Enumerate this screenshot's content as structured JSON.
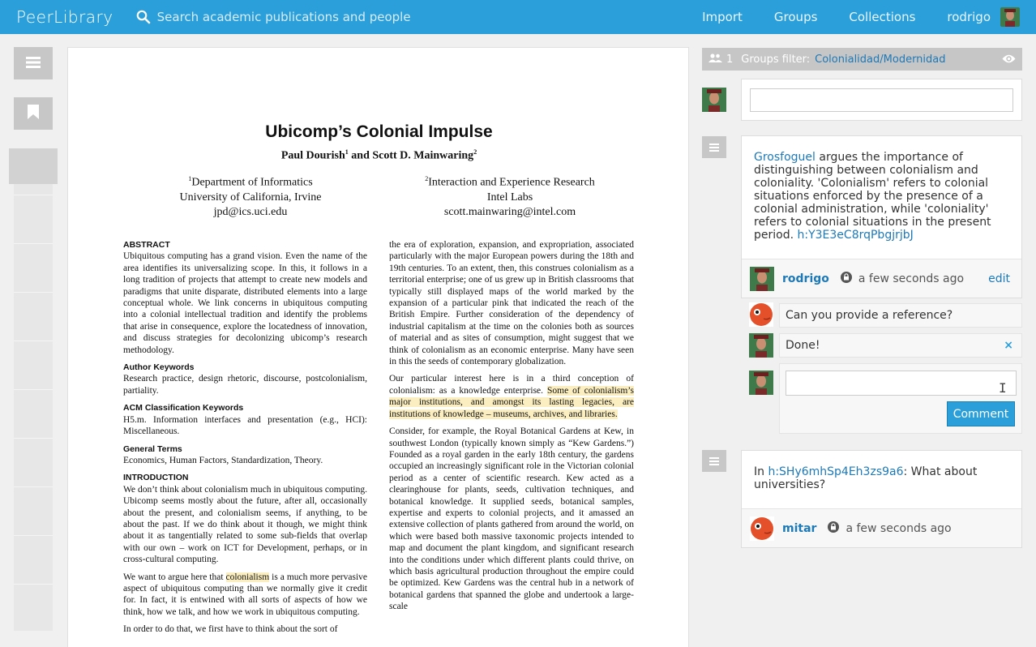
{
  "app": {
    "title": "PeerLibrary"
  },
  "search": {
    "placeholder": "Search academic publications and people"
  },
  "nav": {
    "import": "Import",
    "groups": "Groups",
    "collections": "Collections",
    "user": "rodrigo"
  },
  "paper": {
    "title": "Ubicomp’s Colonial Impulse",
    "authors": {
      "a1": "Paul Dourish",
      "a1_sup": "1",
      "and": " and ",
      "a2": "Scott D. Mainwaring",
      "a2_sup": "2"
    },
    "affiliations": [
      {
        "sup": "1",
        "line1": "Department of Informatics",
        "line2": "University of California, Irvine",
        "line3": "jpd@ics.uci.edu"
      },
      {
        "sup": "2",
        "line1": "Interaction and Experience Research",
        "line2": "Intel Labs",
        "line3": "scott.mainwaring@intel.com"
      }
    ],
    "left": {
      "abstract_h": "ABSTRACT",
      "abstract": "Ubiquitous computing has a grand vision. Even the name of the area identifies its universalizing scope. In this, it follows in a long tradition of projects that attempt to create new models and paradigms that unite disparate, distributed elements into a large conceptual whole. We link concerns in ubiquitous computing into a colonial intellectual tradition and identify the problems that arise in consequence, explore the locatedness of innovation, and discuss strategies for decolonizing ubicomp’s research methodology.",
      "kw_h": "Author Keywords",
      "kw": "Research practice, design rhetoric, discourse, postcolonialism, partiality.",
      "acm_h": "ACM Classification Keywords",
      "acm": "H5.m. Information interfaces and presentation (e.g., HCI): Miscellaneous.",
      "gt_h": "General Terms",
      "gt": "Economics, Human Factors, Standardization, Theory.",
      "intro_h": "INTRODUCTION",
      "intro": "We don’t think about colonialism much in ubiquitous computing. Ubicomp seems mostly about the future, after all, occasionally about the present, and colonialism seems, if anything, to be about the past. If we do think about it though, we might think about it as tangentially related to some sub-fields that overlap with our own – work on ICT for Development, perhaps, or in cross-cultural computing.",
      "p2a": "We want to argue here that ",
      "p2hl": "colonialism",
      "p2b": " is a much more pervasive aspect of ubiquitous computing than we normally give it credit for. In fact, it is entwined with all sorts of aspects of how we think, how we talk, and how we work in ubiquitous computing.",
      "p3": "In order to do that, we first have to think about the sort of"
    },
    "right": {
      "p1": "the era of exploration, expansion, and expropriation, associated particularly with the major European powers during the 18th and 19th centuries. To an extent, then, this construes colonialism as a territorial enterprise; one of us grew up in British classrooms that typically still displayed maps of the world marked by the expansion of a particular pink that indicated the reach of the British Empire. Further consideration of the dependency of industrial capitalism at the time on the colonies both as sources of material and as sites of consumption, might suggest that we think of colonialism as an economic enterprise. Many have seen in this the seeds of contemporary globalization.",
      "p2a": "Our particular interest here is in a third conception of colonialism: as a knowledge enterprise. ",
      "p2hl": "Some of colonialism’s major institutions, and amongst its lasting legacies, are institutions of knowledge – museums, archives, and libraries.",
      "p3": "Consider, for example, the Royal Botanical Gardens at Kew, in southwest London (typically known simply as “Kew Gardens.”) Founded as a royal garden in the early 18th century, the gardens occupied an increasingly significant role in the Victorian colonial period as a center of scientific research. Kew acted as a clearinghouse for plants, seeds, cultivation techniques, and botanical knowledge. It supplied seeds, botanical samples, expertise and experts to colonial projects, and it amassed an extensive collection of plants gathered from around the world, on which were based both massive taxonomic projects intended to map and document the plant kingdom, and significant research into the conditions under which different plants could thrive, on which basis agricultural production throughout the empire could be optimized. Kew Gardens was the central hub in a network of botanical gardens that spanned the globe and undertook a large-scale"
    }
  },
  "filter": {
    "count": "1",
    "label": "Groups filter:",
    "group": "Colonialidad/Modernidad"
  },
  "annotations": [
    {
      "link": "Grosfoguel",
      "text": " argues the importance of distinguishing between colonialism and coloniality. 'Colonialism' refers to colonial situations enforced by the presence of a colonial administration, while 'coloniality' refers to colonial situations in the present period. ",
      "hash": "h:Y3E3eC8rqPbgjrjbJ",
      "author": "rodrigo",
      "time": "a few seconds ago",
      "edit": "edit",
      "replies": [
        {
          "text": "Can you provide a reference?"
        },
        {
          "text": "Done!",
          "close": "×"
        }
      ],
      "comment_button": "Comment"
    },
    {
      "prefix": "In ",
      "hash": "h:SHy6mhSp4Eh3zs9a6",
      "text": ": What about universities?",
      "author": "mitar",
      "time": "a few seconds ago"
    }
  ],
  "icons": {
    "search": "search-icon",
    "menu": "menu-icon",
    "bookmark": "bookmark-icon",
    "users": "users-icon",
    "eye": "eye-icon",
    "lock": "lock-icon"
  },
  "colors": {
    "accent": "#2b9fd9",
    "link": "#1e79b7",
    "highlight": "#fbeec0"
  }
}
